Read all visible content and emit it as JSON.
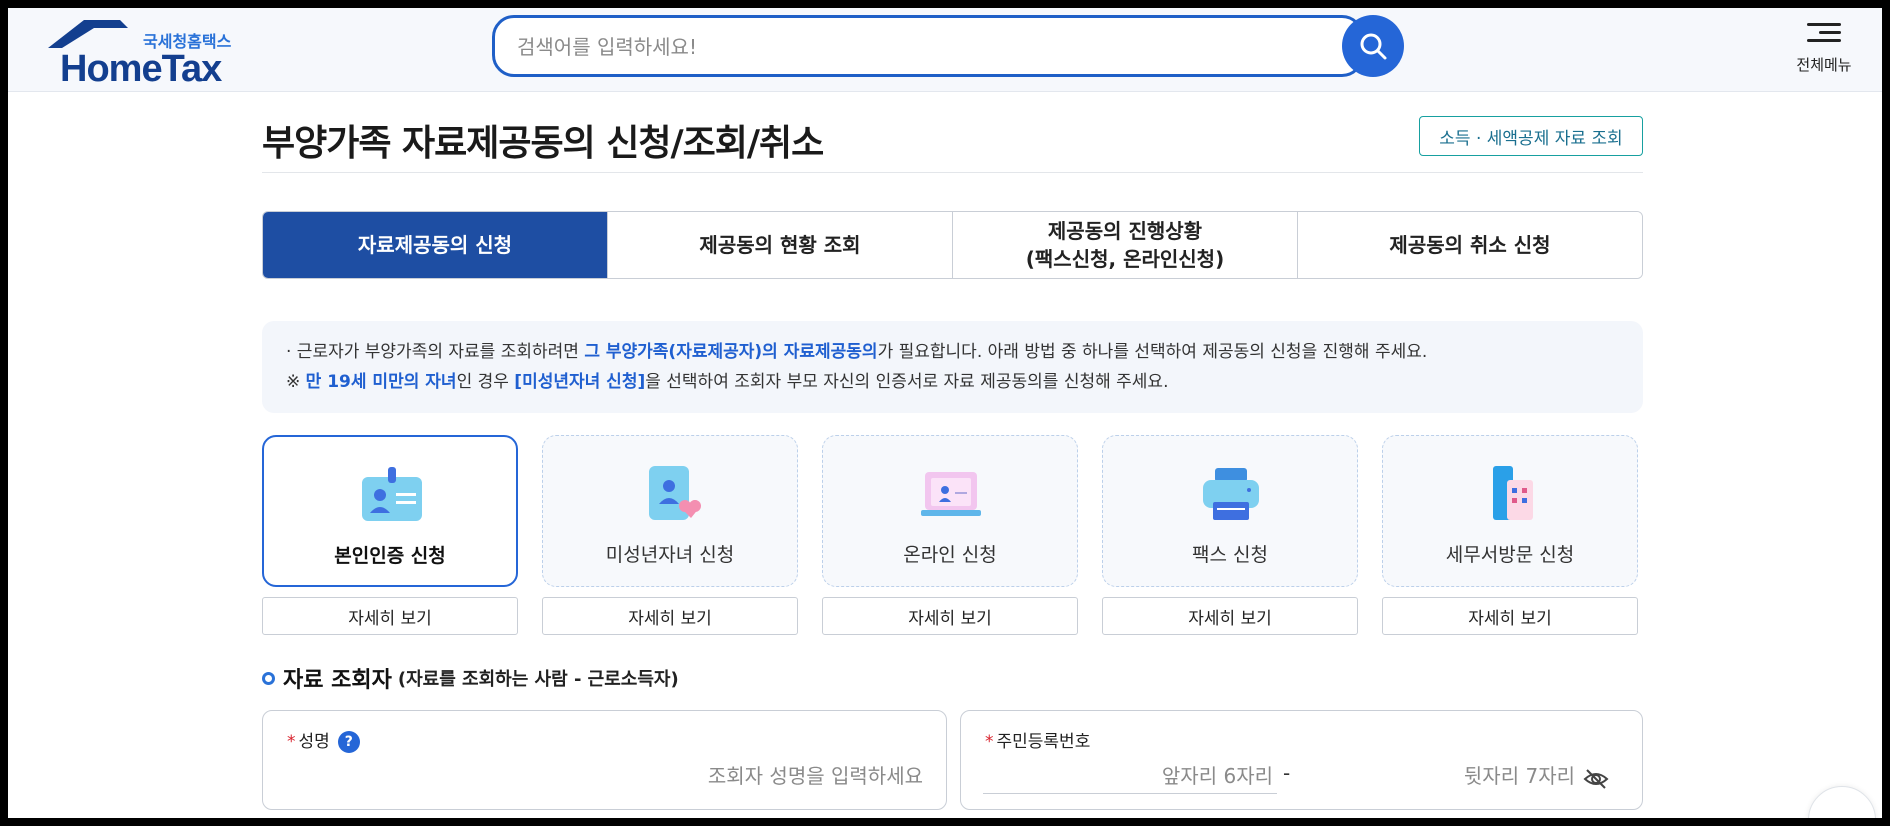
{
  "header": {
    "logo_sub": "국세청홈택스",
    "logo_main": "HomeTax",
    "search_placeholder": "검색어를 입력하세요!",
    "menu_label": "전체메뉴"
  },
  "page": {
    "title": "부양가족 자료제공동의 신청/조회/취소",
    "deduction_button": "소득 · 세액공제 자료 조회"
  },
  "tabs": [
    {
      "line1": "자료제공동의 신청",
      "line2": "",
      "active": true
    },
    {
      "line1": "제공동의 현황 조회",
      "line2": "",
      "active": false
    },
    {
      "line1": "제공동의 진행상황",
      "line2": "(팩스신청, 온라인신청)",
      "active": false
    },
    {
      "line1": "제공동의 취소 신청",
      "line2": "",
      "active": false
    }
  ],
  "notice": {
    "line1_a": "· 근로자가 부양가족의 자료를 조회하려면 ",
    "line1_hl": "그 부양가족(자료제공자)의 자료제공동의",
    "line1_b": "가 필요합니다. 아래 방법 중 하나를 선택하여 제공동의 신청을 진행해 주세요.",
    "line2_a": "※ ",
    "line2_hl1": "만 19세 미만의 자녀",
    "line2_b": "인 경우 ",
    "line2_hl2": "[미성년자녀 신청]",
    "line2_c": "을 선택하여 조회자 부모 자신의 인증서로 자료 제공동의를 신청해 주세요."
  },
  "options": [
    {
      "label": "본인인증 신청",
      "icon": "id-card-icon",
      "selected": true
    },
    {
      "label": "미성년자녀 신청",
      "icon": "child-card-icon",
      "selected": false
    },
    {
      "label": "온라인 신청",
      "icon": "laptop-icon",
      "selected": false
    },
    {
      "label": "팩스 신청",
      "icon": "fax-icon",
      "selected": false
    },
    {
      "label": "세무서방문 신청",
      "icon": "building-icon",
      "selected": false
    }
  ],
  "detail_label": "자세히 보기",
  "section": {
    "title": "자료 조회자",
    "subtitle": "(자료를 조회하는 사람 - 근로소득자)"
  },
  "form": {
    "name_label": "성명",
    "name_help": "?",
    "name_placeholder": "조회자 성명을 입력하세요",
    "rrn_label": "주민등록번호",
    "rrn_front_placeholder": "앞자리 6자리",
    "rrn_separator": "-",
    "rrn_back_placeholder": "뒷자리 7자리"
  },
  "colors": {
    "accent": "#2566d7",
    "tab_active": "#1e4ea3",
    "highlight": "#1f5fd0",
    "required": "#d9232e"
  }
}
